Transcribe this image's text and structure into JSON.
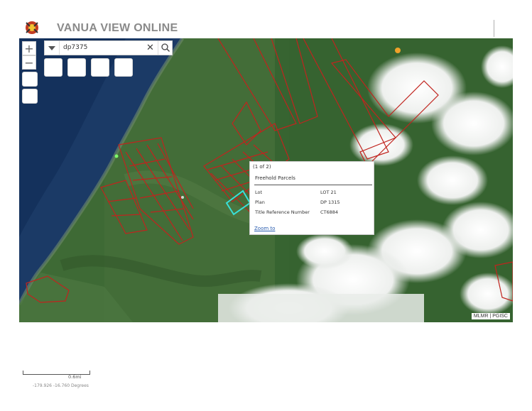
{
  "header": {
    "title": "VANUA VIEW ONLINE"
  },
  "map": {
    "zoom_in_label": "+",
    "zoom_out_label": "−",
    "search": {
      "value": "dp7375",
      "clear_icon": "✕"
    },
    "popup": {
      "count": "(1 of 2)",
      "heading": "Freehold Parcels",
      "rows": [
        {
          "label": "Lot",
          "value": "LOT 21"
        },
        {
          "label": "Plan",
          "value": "DP 1315"
        },
        {
          "label": "Title Reference Number",
          "value": "CT6884"
        }
      ],
      "zoom_link": "Zoom to"
    },
    "attribution": "MLMR | PGISC",
    "colors": {
      "parcel_outline": "#c0241e",
      "selected_parcel": "#38e0d8",
      "sea": "#1a3b66",
      "land": "#3f6a36"
    },
    "icons": [
      "search-icon",
      "clear-icon",
      "dropdown-icon",
      "logo-icon"
    ]
  },
  "footer": {
    "scale_label": "0.6mi",
    "coordinates": "-179.926 -16.760 Degrees"
  }
}
